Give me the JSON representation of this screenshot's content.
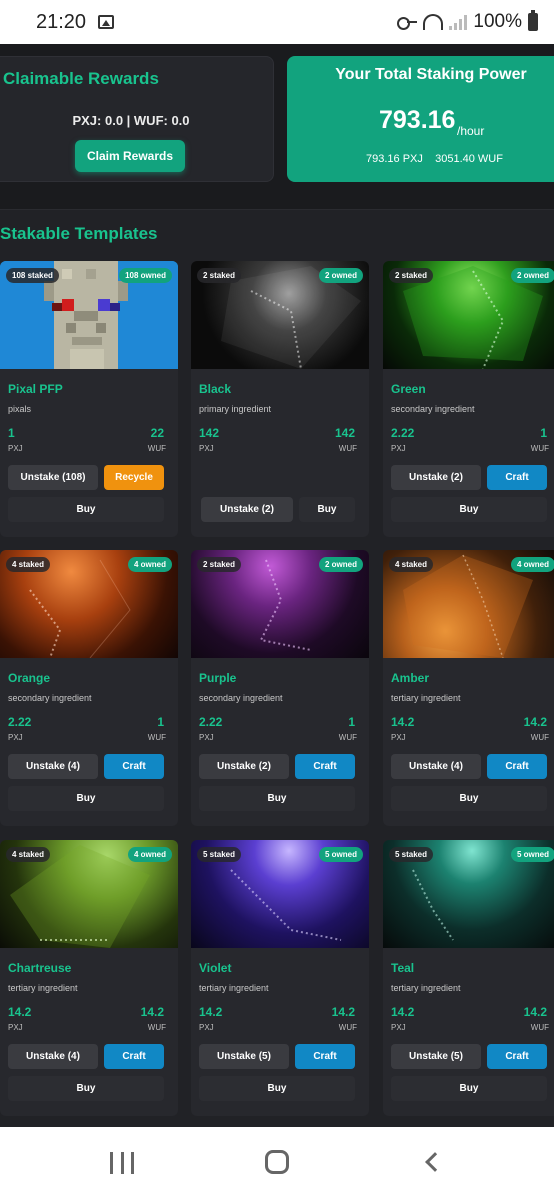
{
  "status_bar": {
    "time": "21:20",
    "battery": "100%"
  },
  "claim": {
    "title": "Claimable Rewards",
    "values": "PXJ: 0.0 | WUF: 0.0",
    "button": "Claim Rewards"
  },
  "power": {
    "title": "Your Total Staking Power",
    "value": "793.16",
    "unit": "/hour",
    "pxj": "793.16 PXJ",
    "wuf": "3051.40 WUF"
  },
  "section_title": "Stakable Templates",
  "cards": [
    {
      "name": "Pixal PFP",
      "type": "pixals",
      "staked": "108 staked",
      "owned": "108 owned",
      "pxj": "1",
      "wuf": "22",
      "u1": "PXJ",
      "u2": "WUF",
      "unstake": "Unstake (108)",
      "action": "Recycle",
      "buy": "Buy"
    },
    {
      "name": "Black",
      "type": "primary ingredient",
      "staked": "2 staked",
      "owned": "2 owned",
      "pxj": "142",
      "wuf": "142",
      "u1": "PXJ",
      "u2": "WUF",
      "unstake": "Unstake (2)",
      "buy": "Buy"
    },
    {
      "name": "Green",
      "type": "secondary ingredient",
      "staked": "2 staked",
      "owned": "2 owned",
      "pxj": "2.22",
      "wuf": "1",
      "u1": "PXJ",
      "u2": "WUF",
      "unstake": "Unstake (2)",
      "action": "Craft",
      "buy": "Buy"
    },
    {
      "name": "Orange",
      "type": "secondary ingredient",
      "staked": "4 staked",
      "owned": "4 owned",
      "pxj": "2.22",
      "wuf": "1",
      "u1": "PXJ",
      "u2": "WUF",
      "unstake": "Unstake (4)",
      "action": "Craft",
      "buy": "Buy"
    },
    {
      "name": "Purple",
      "type": "secondary ingredient",
      "staked": "2 staked",
      "owned": "2 owned",
      "pxj": "2.22",
      "wuf": "1",
      "u1": "PXJ",
      "u2": "WUF",
      "unstake": "Unstake (2)",
      "action": "Craft",
      "buy": "Buy"
    },
    {
      "name": "Amber",
      "type": "tertiary ingredient",
      "staked": "4 staked",
      "owned": "4 owned",
      "pxj": "14.2",
      "wuf": "14.2",
      "u1": "PXJ",
      "u2": "WUF",
      "unstake": "Unstake (4)",
      "action": "Craft",
      "buy": "Buy"
    },
    {
      "name": "Chartreuse",
      "type": "tertiary ingredient",
      "staked": "4 staked",
      "owned": "4 owned",
      "pxj": "14.2",
      "wuf": "14.2",
      "u1": "PXJ",
      "u2": "WUF",
      "unstake": "Unstake (4)",
      "action": "Craft",
      "buy": "Buy"
    },
    {
      "name": "Violet",
      "type": "tertiary ingredient",
      "staked": "5 staked",
      "owned": "5 owned",
      "pxj": "14.2",
      "wuf": "14.2",
      "u1": "PXJ",
      "u2": "WUF",
      "unstake": "Unstake (5)",
      "action": "Craft",
      "buy": "Buy"
    },
    {
      "name": "Teal",
      "type": "tertiary ingredient",
      "staked": "5 staked",
      "owned": "5 owned",
      "pxj": "14.2",
      "wuf": "14.2",
      "u1": "PXJ",
      "u2": "WUF",
      "unstake": "Unstake (5)",
      "action": "Craft",
      "buy": "Buy"
    }
  ],
  "colors": {
    "accent": "#19c38e",
    "accent_dark": "#12a37e",
    "craft": "#1188c5",
    "recycle": "#f0920e",
    "background": "#1a1b1e"
  },
  "nav": {
    "recents_icon": "recents-icon",
    "home_icon": "home-icon",
    "back_icon": "back-icon"
  }
}
